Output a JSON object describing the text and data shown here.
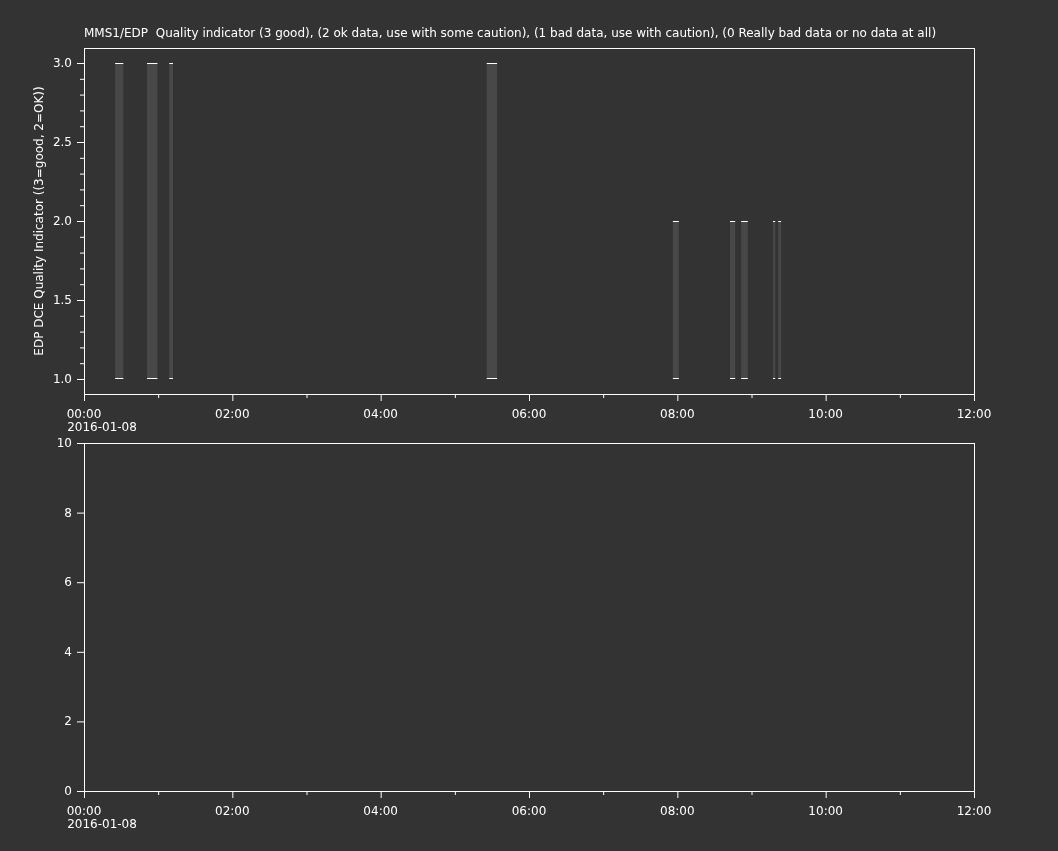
{
  "charts": [
    {
      "chart_data": {
        "type": "line",
        "title": "MMS1/EDP  Quality indicator (3 good), (2 ok data, use with some caution), (1 bad data, use with caution), (0 Really bad data or no data at all)",
        "ylabel": "EDP DCE Quality Indicator ((3=good, 2=OK))",
        "xlim": [
          0,
          12
        ],
        "ylim": [
          0.905,
          3.095
        ],
        "xticks": [
          {
            "value": 0,
            "label": "00:00"
          },
          {
            "value": 2,
            "label": "02:00"
          },
          {
            "value": 4,
            "label": "04:00"
          },
          {
            "value": 6,
            "label": "06:00"
          },
          {
            "value": 8,
            "label": "08:00"
          },
          {
            "value": 10,
            "label": "10:00"
          },
          {
            "value": 12,
            "label": "12:00"
          }
        ],
        "yticks": [
          {
            "value": 1,
            "label": "1.0"
          },
          {
            "value": 1.5,
            "label": "1.5"
          },
          {
            "value": 2,
            "label": "2.0"
          },
          {
            "value": 2.5,
            "label": "2.5"
          },
          {
            "value": 3,
            "label": "3.0"
          }
        ]
      },
      "date_label": "2016-01-08"
    },
    {
      "chart_data": {
        "type": "line",
        "xlim": [
          0,
          12
        ],
        "ylim": [
          0,
          10
        ],
        "xticks": [
          {
            "value": 0,
            "label": "00:00"
          },
          {
            "value": 2,
            "label": "02:00"
          },
          {
            "value": 4,
            "label": "04:00"
          },
          {
            "value": 6,
            "label": "06:00"
          },
          {
            "value": 8,
            "label": "08:00"
          },
          {
            "value": 10,
            "label": "10:00"
          },
          {
            "value": 12,
            "label": "12:00"
          }
        ],
        "yticks": [
          0,
          2,
          4,
          6,
          8,
          10
        ]
      },
      "date_label": "2016-01-08"
    }
  ]
}
